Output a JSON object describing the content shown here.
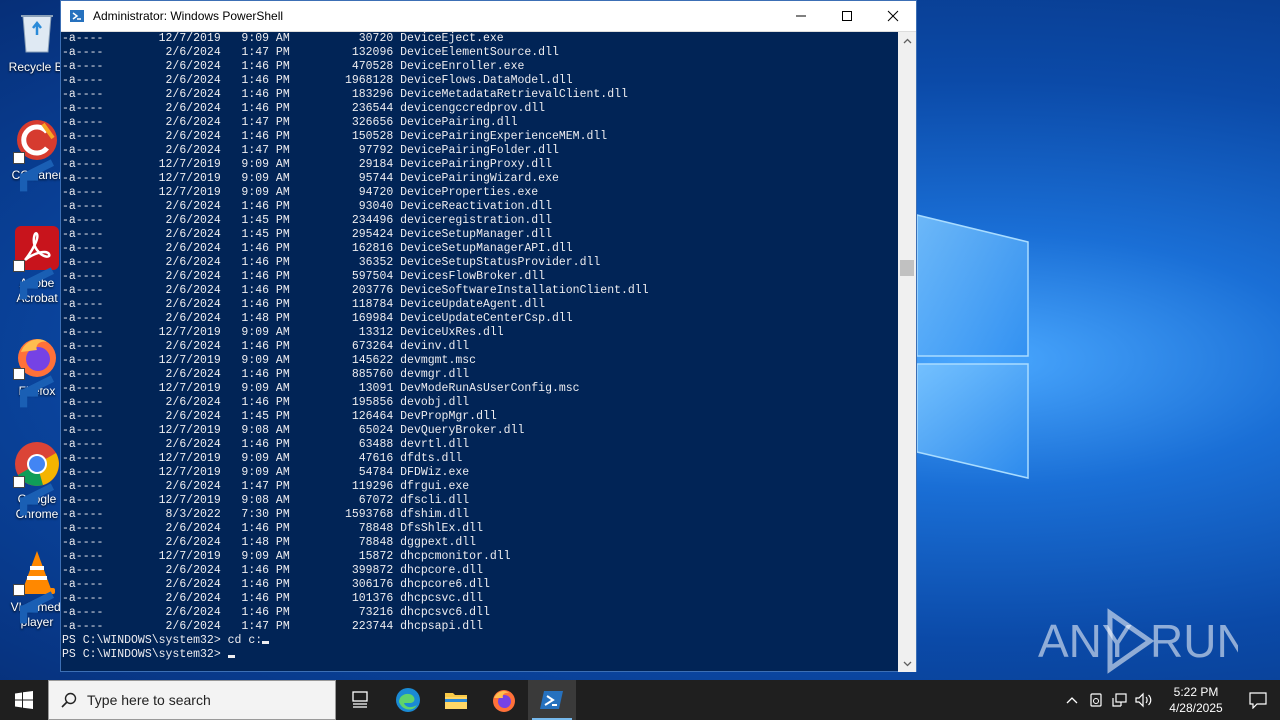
{
  "desktop": {
    "icons": [
      {
        "label": "Recycle Bin",
        "label_visible": "Recycle Bi"
      },
      {
        "label": "CCleaner",
        "label_visible": "CCleaner"
      },
      {
        "label": "Adobe Acrobat",
        "label_visible": "Adobe\nAcrobat"
      },
      {
        "label": "Firefox",
        "label_visible": "Firefox"
      },
      {
        "label": "Google Chrome",
        "label_visible": "Google\nChrome"
      },
      {
        "label": "VLC media player",
        "label_visible": "VLC medi\nplayer"
      }
    ]
  },
  "window": {
    "title": "Administrator: Windows PowerShell",
    "lines": [
      "-a----        12/7/2019   9:09 AM          30720 DeviceEject.exe",
      "-a----         2/6/2024   1:47 PM         132096 DeviceElementSource.dll",
      "-a----         2/6/2024   1:46 PM         470528 DeviceEnroller.exe",
      "-a----         2/6/2024   1:46 PM        1968128 DeviceFlows.DataModel.dll",
      "-a----         2/6/2024   1:46 PM         183296 DeviceMetadataRetrievalClient.dll",
      "-a----         2/6/2024   1:46 PM         236544 devicengccredprov.dll",
      "-a----         2/6/2024   1:47 PM         326656 DevicePairing.dll",
      "-a----         2/6/2024   1:46 PM         150528 DevicePairingExperienceMEM.dll",
      "-a----         2/6/2024   1:47 PM          97792 DevicePairingFolder.dll",
      "-a----        12/7/2019   9:09 AM          29184 DevicePairingProxy.dll",
      "-a----        12/7/2019   9:09 AM          95744 DevicePairingWizard.exe",
      "-a----        12/7/2019   9:09 AM          94720 DeviceProperties.exe",
      "-a----         2/6/2024   1:46 PM          93040 DeviceReactivation.dll",
      "-a----         2/6/2024   1:45 PM         234496 deviceregistration.dll",
      "-a----         2/6/2024   1:45 PM         295424 DeviceSetupManager.dll",
      "-a----         2/6/2024   1:46 PM         162816 DeviceSetupManagerAPI.dll",
      "-a----         2/6/2024   1:46 PM          36352 DeviceSetupStatusProvider.dll",
      "-a----         2/6/2024   1:46 PM         597504 DevicesFlowBroker.dll",
      "-a----         2/6/2024   1:46 PM         203776 DeviceSoftwareInstallationClient.dll",
      "-a----         2/6/2024   1:46 PM         118784 DeviceUpdateAgent.dll",
      "-a----         2/6/2024   1:48 PM         169984 DeviceUpdateCenterCsp.dll",
      "-a----        12/7/2019   9:09 AM          13312 DeviceUxRes.dll",
      "-a----         2/6/2024   1:46 PM         673264 devinv.dll",
      "-a----        12/7/2019   9:09 AM         145622 devmgmt.msc",
      "-a----         2/6/2024   1:46 PM         885760 devmgr.dll",
      "-a----        12/7/2019   9:09 AM          13091 DevModeRunAsUserConfig.msc",
      "-a----         2/6/2024   1:46 PM         195856 devobj.dll",
      "-a----         2/6/2024   1:45 PM         126464 DevPropMgr.dll",
      "-a----        12/7/2019   9:08 AM          65024 DevQueryBroker.dll",
      "-a----         2/6/2024   1:46 PM          63488 devrtl.dll",
      "-a----        12/7/2019   9:09 AM          47616 dfdts.dll",
      "-a----        12/7/2019   9:09 AM          54784 DFDWiz.exe",
      "-a----         2/6/2024   1:47 PM         119296 dfrgui.exe",
      "-a----        12/7/2019   9:08 AM          67072 dfscli.dll",
      "-a----         8/3/2022   7:30 PM        1593768 dfshim.dll",
      "-a----         2/6/2024   1:46 PM          78848 DfsShlEx.dll",
      "-a----         2/6/2024   1:48 PM          78848 dggpext.dll",
      "-a----        12/7/2019   9:09 AM          15872 dhcpcmonitor.dll",
      "-a----         2/6/2024   1:46 PM         399872 dhcpcore.dll",
      "-a----         2/6/2024   1:46 PM         306176 dhcpcore6.dll",
      "-a----         2/6/2024   1:46 PM         101376 dhcpcsvc.dll",
      "-a----         2/6/2024   1:46 PM          73216 dhcpcsvc6.dll",
      "-a----         2/6/2024   1:47 PM         223744 dhcpsapi.dll"
    ],
    "prompt1": "PS C:\\WINDOWS\\system32> ",
    "command1": "cd c:",
    "prompt2": "PS C:\\WINDOWS\\system32> "
  },
  "watermark": "ANY RUN",
  "taskbar": {
    "search_placeholder": "Type here to search",
    "time": "5:22 PM",
    "date": "4/28/2025"
  },
  "colors": {
    "ps_background": "#012456",
    "ps_text": "#eeedf0",
    "taskbar": "#1f1f1f"
  }
}
